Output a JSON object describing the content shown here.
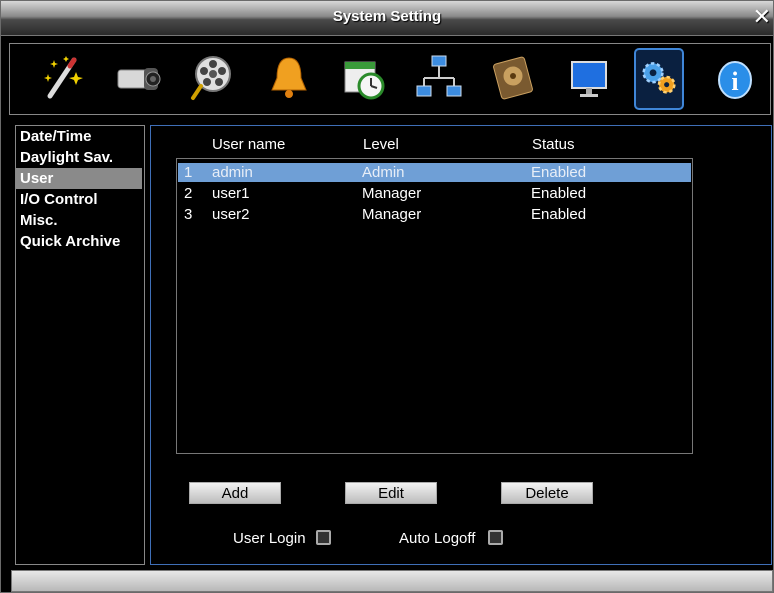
{
  "window": {
    "title": "System Setting"
  },
  "toolbar": {
    "icons": [
      {
        "name": "wizard-wand-icon",
        "selected": false
      },
      {
        "name": "camera-icon",
        "selected": false
      },
      {
        "name": "film-reel-search-icon",
        "selected": false
      },
      {
        "name": "alarm-bell-icon",
        "selected": false
      },
      {
        "name": "schedule-clock-icon",
        "selected": false
      },
      {
        "name": "network-icon",
        "selected": false
      },
      {
        "name": "hdd-disk-icon",
        "selected": false
      },
      {
        "name": "monitor-display-icon",
        "selected": false
      },
      {
        "name": "system-gears-icon",
        "selected": true
      },
      {
        "name": "info-icon",
        "selected": false
      }
    ]
  },
  "sidebar": {
    "items": [
      {
        "label": "Date/Time"
      },
      {
        "label": "Daylight Sav."
      },
      {
        "label": "User",
        "active": true
      },
      {
        "label": "I/O Control"
      },
      {
        "label": "Misc."
      },
      {
        "label": "Quick Archive"
      }
    ]
  },
  "users": {
    "columns": {
      "name": "User name",
      "level": "Level",
      "status": "Status"
    },
    "rows": [
      {
        "num": "1",
        "name": "admin",
        "level": "Admin",
        "status": "Enabled",
        "selected": true
      },
      {
        "num": "2",
        "name": "user1",
        "level": "Manager",
        "status": "Enabled"
      },
      {
        "num": "3",
        "name": "user2",
        "level": "Manager",
        "status": "Enabled"
      }
    ]
  },
  "buttons": {
    "add": "Add",
    "edit": "Edit",
    "delete": "Delete"
  },
  "options": {
    "user_login": "User Login",
    "auto_logoff": "Auto Logoff"
  },
  "colors": {
    "selection": "#6f9fd6",
    "panel_border": "#3f6fb8",
    "selected_icon_border": "#3f86d8"
  }
}
